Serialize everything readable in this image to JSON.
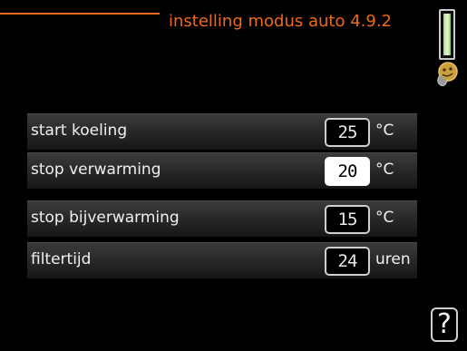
{
  "screen": {
    "title": "instelling modus auto 4.9.2"
  },
  "settings": [
    {
      "label": "start koeling",
      "value": "25",
      "unit": "°C",
      "selected": false
    },
    {
      "label": "stop verwarming",
      "value": "20",
      "unit": "°C",
      "selected": true
    },
    {
      "label": "stop bijverwarming",
      "value": "15",
      "unit": "°C",
      "selected": false
    },
    {
      "label": "filtertijd",
      "value": "24",
      "unit": "uren",
      "selected": false
    }
  ],
  "help": {
    "label": "?"
  },
  "icons": {
    "scroll": "scroll-indicator-icon",
    "mascot": "mascot-icon",
    "help": "help-icon"
  },
  "colors": {
    "accent": "#ee6a1a",
    "scroll_thumb": "#a9d87e"
  }
}
